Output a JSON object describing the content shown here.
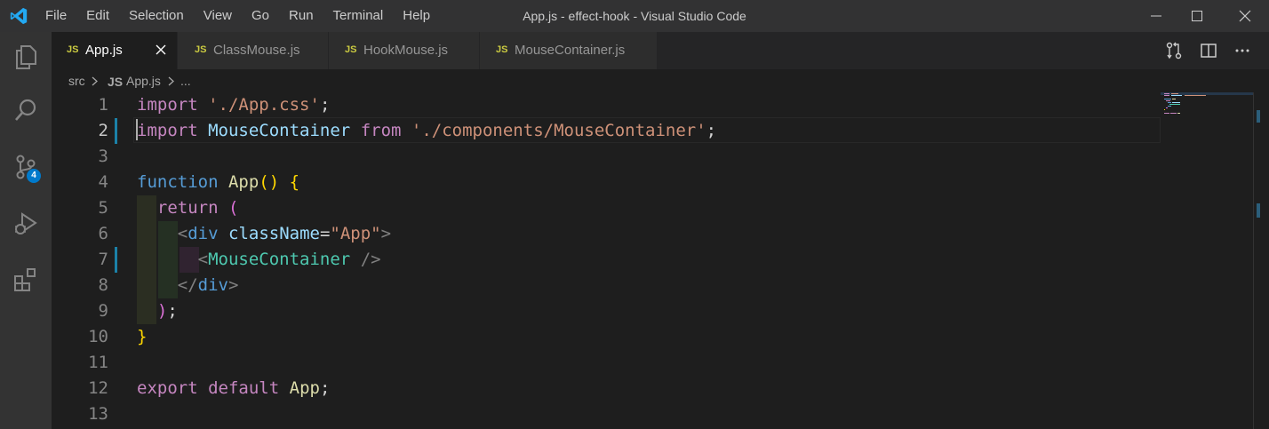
{
  "titlebar": {
    "menu": [
      "File",
      "Edit",
      "Selection",
      "View",
      "Go",
      "Run",
      "Terminal",
      "Help"
    ],
    "window_title": "App.js - effect-hook - Visual Studio Code"
  },
  "activity": {
    "source_control_badge": "4"
  },
  "tabs": [
    {
      "label": "App.js",
      "icon": "JS",
      "active": true
    },
    {
      "label": "ClassMouse.js",
      "icon": "JS",
      "active": false
    },
    {
      "label": "HookMouse.js",
      "icon": "JS",
      "active": false
    },
    {
      "label": "MouseContainer.js",
      "icon": "JS",
      "active": false
    }
  ],
  "breadcrumb": {
    "folder": "src",
    "icon": "JS",
    "file": "App.js",
    "more": "..."
  },
  "editor": {
    "line_numbers": [
      "1",
      "2",
      "3",
      "4",
      "5",
      "6",
      "7",
      "8",
      "9",
      "10",
      "11",
      "12",
      "13"
    ],
    "lines": [
      [
        {
          "t": "import",
          "c": "kw"
        },
        {
          "t": " "
        },
        {
          "t": "'./App.css'",
          "c": "str"
        },
        {
          "t": ";"
        }
      ],
      [
        {
          "t": "import",
          "c": "kw"
        },
        {
          "t": " "
        },
        {
          "t": "MouseContainer",
          "c": "var"
        },
        {
          "t": " "
        },
        {
          "t": "from",
          "c": "kw"
        },
        {
          "t": " "
        },
        {
          "t": "'./components/MouseContainer'",
          "c": "str"
        },
        {
          "t": ";"
        }
      ],
      [],
      [
        {
          "t": "function",
          "c": "kb"
        },
        {
          "t": " "
        },
        {
          "t": "App",
          "c": "fn"
        },
        {
          "t": "()",
          "c": "br1"
        },
        {
          "t": " "
        },
        {
          "t": "{",
          "c": "br1"
        }
      ],
      [
        {
          "t": "  "
        },
        {
          "t": "return",
          "c": "kw"
        },
        {
          "t": " "
        },
        {
          "t": "(",
          "c": "br2"
        }
      ],
      [
        {
          "t": "    "
        },
        {
          "t": "<",
          "c": "pun"
        },
        {
          "t": "div",
          "c": "tag"
        },
        {
          "t": " "
        },
        {
          "t": "className",
          "c": "attr"
        },
        {
          "t": "="
        },
        {
          "t": "\"App\"",
          "c": "str"
        },
        {
          "t": ">",
          "c": "pun"
        }
      ],
      [
        {
          "t": "      "
        },
        {
          "t": "<",
          "c": "pun"
        },
        {
          "t": "MouseContainer",
          "c": "comp"
        },
        {
          "t": " "
        },
        {
          "t": "/>",
          "c": "pun"
        }
      ],
      [
        {
          "t": "    "
        },
        {
          "t": "</",
          "c": "pun"
        },
        {
          "t": "div",
          "c": "tag"
        },
        {
          "t": ">",
          "c": "pun"
        }
      ],
      [
        {
          "t": "  "
        },
        {
          "t": ")",
          "c": "br2"
        },
        {
          "t": ";"
        }
      ],
      [
        {
          "t": "}",
          "c": "br1"
        }
      ],
      [],
      [
        {
          "t": "export",
          "c": "kw"
        },
        {
          "t": " "
        },
        {
          "t": "default",
          "c": "kw"
        },
        {
          "t": " "
        },
        {
          "t": "App",
          "c": "fn"
        },
        {
          "t": ";"
        }
      ],
      []
    ],
    "current_line": 2,
    "modified_lines": [
      2,
      7
    ]
  },
  "colors": {
    "keyword": "#c586c0",
    "storage": "#569cd6",
    "function": "#dcdcaa",
    "string": "#ce9178",
    "variable": "#9cdcfe",
    "component": "#4ec9b0",
    "bracket1": "#ffd700",
    "bracket2": "#da70d6",
    "accent": "#007acc",
    "gutter_modified": "#1b81a8"
  }
}
